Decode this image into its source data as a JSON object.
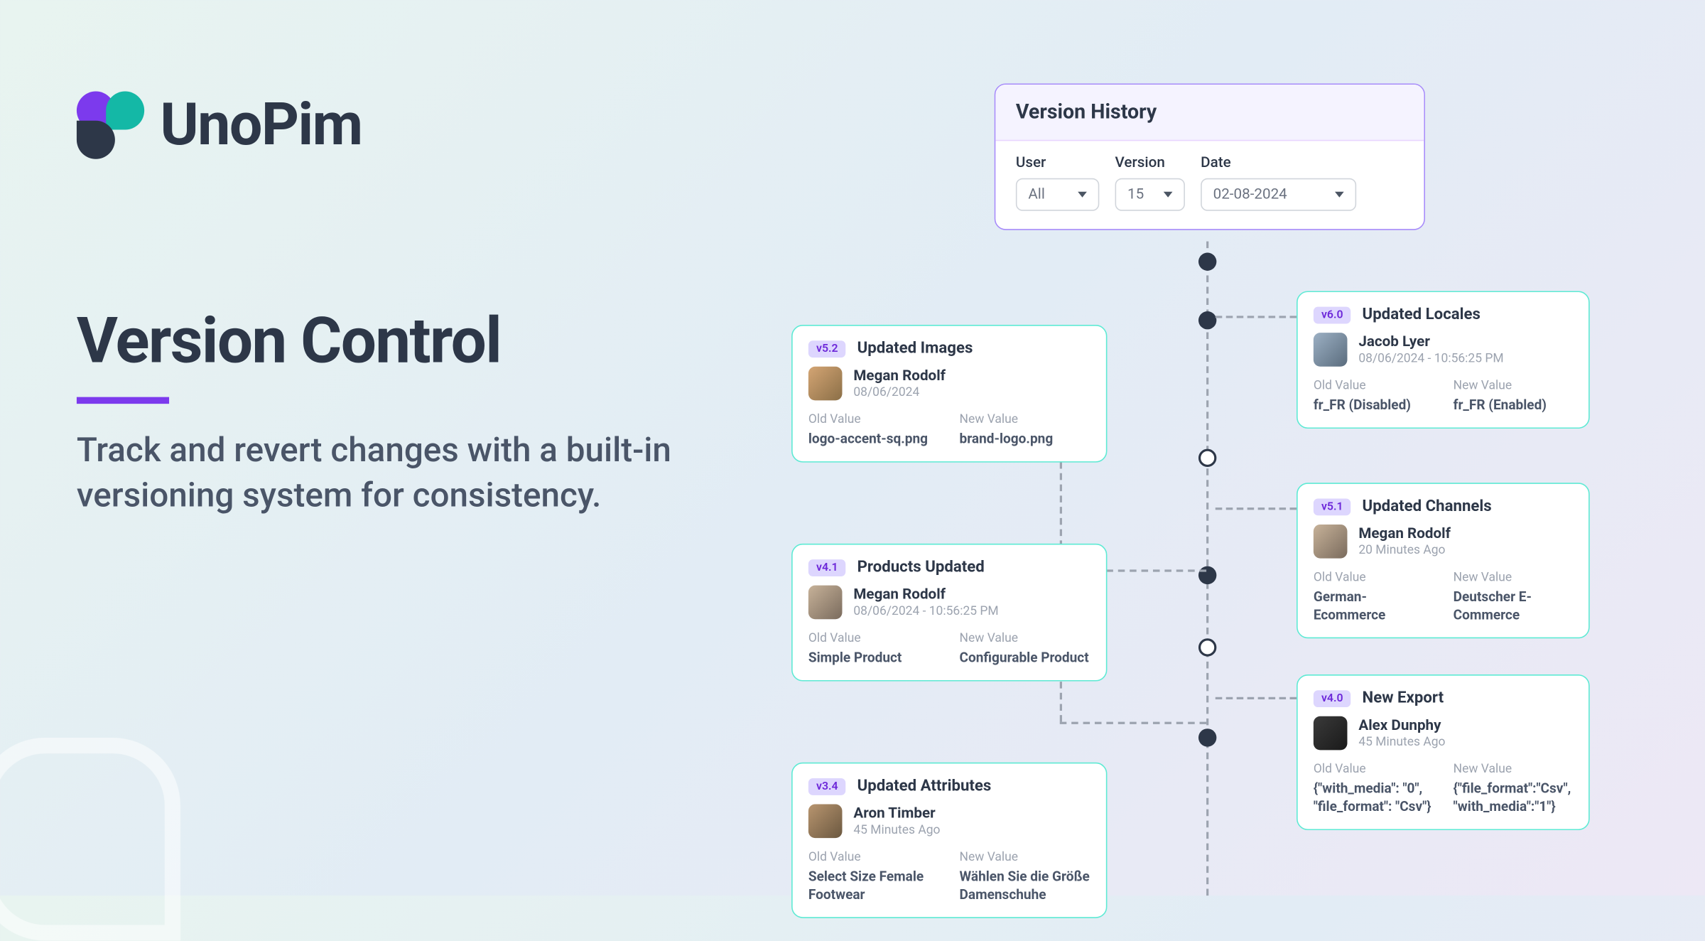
{
  "brand": {
    "name": "UnoPim"
  },
  "hero": {
    "title": "Version Control",
    "subtitle": "Track and revert changes with a built-in versioning system for consistency."
  },
  "panel": {
    "title": "Version History",
    "filters": {
      "user": {
        "label": "User",
        "value": "All"
      },
      "version": {
        "label": "Version",
        "value": "15"
      },
      "date": {
        "label": "Date",
        "value": "02-08-2024"
      }
    }
  },
  "entries": [
    {
      "badge": "v5.2",
      "title": "Updated Images",
      "user": "Megan Rodolf",
      "time": "08/06/2024",
      "old_label": "Old Value",
      "old": "logo-accent-sq.png",
      "new_label": "New Value",
      "new": "brand-logo.png"
    },
    {
      "badge": "v4.1",
      "title": "Products Updated",
      "user": "Megan Rodolf",
      "time": "08/06/2024 - 10:56:25 PM",
      "old_label": "Old Value",
      "old": "Simple Product",
      "new_label": "New Value",
      "new": "Configurable Product"
    },
    {
      "badge": "v3.4",
      "title": "Updated Attributes",
      "user": "Aron Timber",
      "time": "45 Minutes Ago",
      "old_label": "Old Value",
      "old": "Select Size Female Footwear",
      "new_label": "New Value",
      "new": "Wählen Sie die Größe Damenschuhe"
    },
    {
      "badge": "v6.0",
      "title": "Updated Locales",
      "user": "Jacob Lyer",
      "time": "08/06/2024 - 10:56:25 PM",
      "old_label": "Old Value",
      "old": "fr_FR (Disabled)",
      "new_label": "New Value",
      "new": "fr_FR (Enabled)"
    },
    {
      "badge": "v5.1",
      "title": "Updated Channels",
      "user": "Megan Rodolf",
      "time": "20 Minutes Ago",
      "old_label": "Old Value",
      "old": "German-Ecommerce",
      "new_label": "New Value",
      "new": "Deutscher E-Commerce"
    },
    {
      "badge": "v4.0",
      "title": "New Export",
      "user": "Alex Dunphy",
      "time": "45 Minutes Ago",
      "old_label": "Old Value",
      "old": "{\"with_media\": \"0\", \"file_format\": \"Csv\"}",
      "new_label": "New Value",
      "new": "{\"file_format\":\"Csv\",\"with_media\":\"1\"}"
    }
  ]
}
